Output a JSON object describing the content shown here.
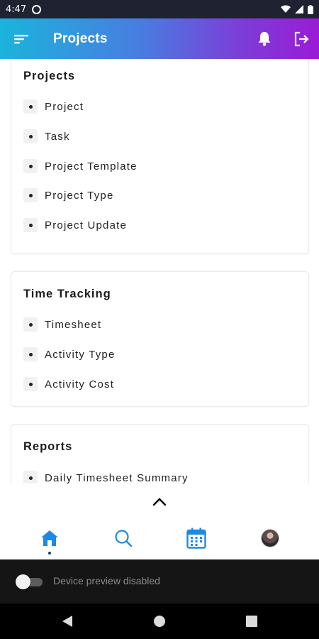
{
  "status_bar": {
    "time": "4:47"
  },
  "header": {
    "title": "Projects"
  },
  "sections": [
    {
      "title": "Projects",
      "items": [
        "Project",
        "Task",
        "Project Template",
        "Project Type",
        "Project Update"
      ]
    },
    {
      "title": "Time Tracking",
      "items": [
        "Timesheet",
        "Activity Type",
        "Activity Cost"
      ]
    },
    {
      "title": "Reports",
      "items": [
        "Daily Timesheet Summary"
      ]
    }
  ],
  "bottom_nav": {
    "active": "home"
  },
  "device_preview": {
    "label": "Device preview disabled",
    "enabled": false
  },
  "icons": {
    "menu": "menu-icon",
    "bell": "bell-icon",
    "logout": "logout-icon",
    "home": "home-icon",
    "search": "search-icon",
    "calendar": "calendar-icon",
    "chevron": "chevron-up-icon"
  },
  "colors": {
    "accent": "#1e88e5",
    "gradient_start": "#1bb4dc",
    "gradient_end": "#9b1bd6"
  }
}
